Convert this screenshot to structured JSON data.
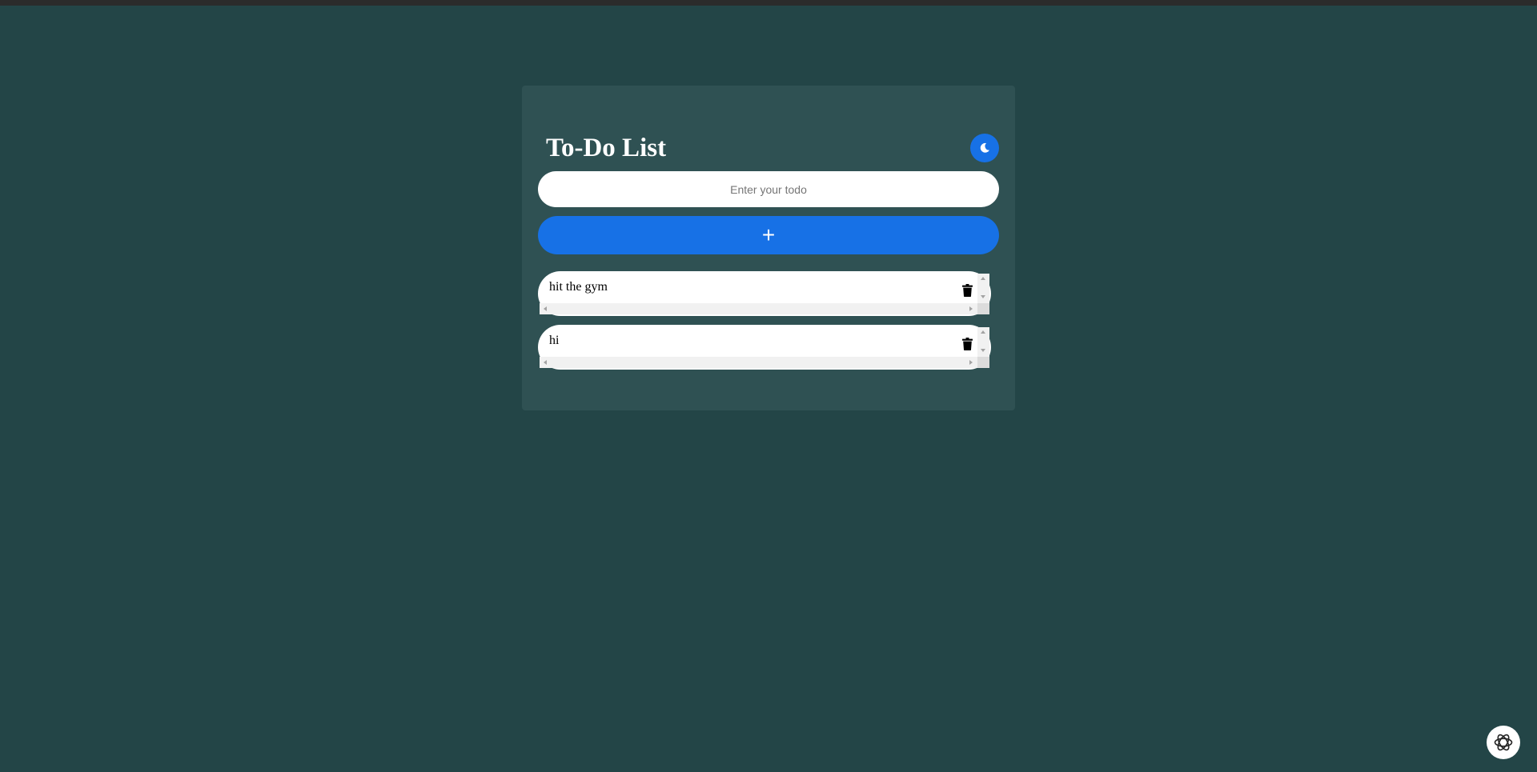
{
  "app": {
    "title": "To-Do List"
  },
  "theme_toggle": {
    "icon": "moon-icon"
  },
  "input": {
    "placeholder": "Enter your todo",
    "value": ""
  },
  "add_button": {
    "label": "+"
  },
  "todos": [
    {
      "text": "hit the gym",
      "delete_icon": "trash-icon"
    },
    {
      "text": "hi",
      "delete_icon": "trash-icon"
    }
  ],
  "assistant_button": {
    "icon": "openai-logo-icon"
  },
  "colors": {
    "background": "#234547",
    "card": "#2f5153",
    "accent": "#1771e6",
    "text_light": "#ffffff"
  }
}
